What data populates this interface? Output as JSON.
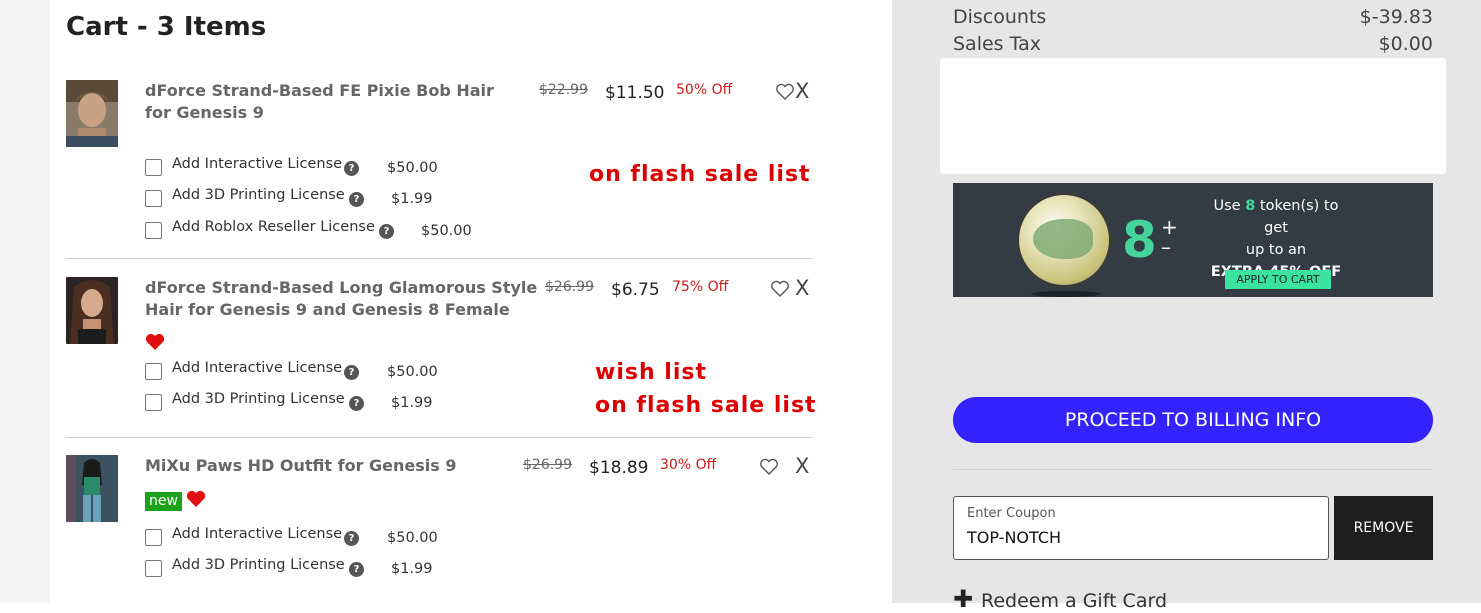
{
  "cart": {
    "title": "Cart - 3 Items",
    "items": [
      {
        "name": "dForce Strand-Based FE Pixie Bob Hair for Genesis 9",
        "original_price": "$22.99",
        "sale_price": "$11.50",
        "discount": "50% Off",
        "delete_label": "X",
        "licenses": [
          {
            "label": "Add Interactive License",
            "price": "$50.00",
            "help": "?"
          },
          {
            "label": "Add 3D Printing License",
            "price": "$1.99",
            "help": "?"
          },
          {
            "label": "Add Roblox Reseller License",
            "price": "$50.00",
            "help": "?"
          }
        ]
      },
      {
        "name": "dForce Strand-Based Long Glamorous Style Hair for Genesis 9 and Genesis 8 Female",
        "original_price": "$26.99",
        "sale_price": "$6.75",
        "discount": "75% Off",
        "delete_label": "X",
        "licenses": [
          {
            "label": "Add Interactive License",
            "price": "$50.00",
            "help": "?"
          },
          {
            "label": "Add 3D Printing License",
            "price": "$1.99",
            "help": "?"
          }
        ]
      },
      {
        "name": "MiXu Paws HD Outfit for Genesis 9",
        "original_price": "$26.99",
        "sale_price": "$18.89",
        "discount": "30% Off",
        "delete_label": "X",
        "badge": "new",
        "licenses": [
          {
            "label": "Add Interactive License",
            "price": "$50.00",
            "help": "?"
          },
          {
            "label": "Add 3D Printing License",
            "price": "$1.99",
            "help": "?"
          }
        ]
      }
    ]
  },
  "annotations": {
    "item1": "on flash sale list",
    "item2_line1": "wish list",
    "item2_line2": "on flash sale list"
  },
  "summary": {
    "discounts_label": "Discounts",
    "discounts_value": "$-39.83",
    "tax_label": "Sales Tax",
    "tax_value": "$0.00"
  },
  "tokens": {
    "count": "8",
    "plus": "+",
    "minus": "–",
    "text_before": "Use",
    "text_count": "8",
    "text_after": "token(s) to get",
    "text_line2": "up to an",
    "text_line3": "EXTRA 45% OFF",
    "apply_label": "APPLY TO CART"
  },
  "checkout": {
    "proceed_label": "PROCEED TO BILLING INFO"
  },
  "coupon": {
    "label": "Enter Coupon",
    "value": "TOP-NOTCH",
    "remove_label": "REMOVE"
  },
  "gift": {
    "label": "Redeem a Gift Card"
  },
  "colors": {
    "accent": "#3423ff",
    "discount_red": "#cc1a1a",
    "annotation_red": "#dd0000",
    "token_green": "#45d49a",
    "new_badge": "#1aa31a",
    "heart": "#e01010"
  },
  "icons": [
    "heart-outline-icon",
    "heart-filled-icon",
    "help-icon",
    "plus-icon",
    "close-icon",
    "token-coin-icon"
  ]
}
